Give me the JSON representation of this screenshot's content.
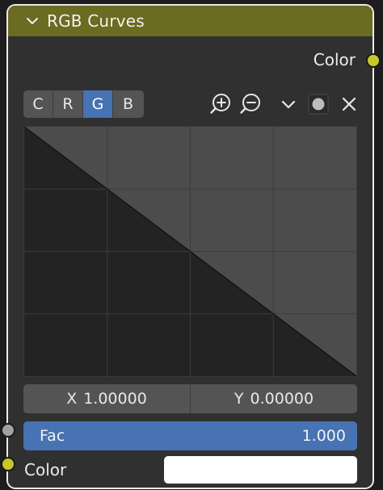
{
  "node": {
    "title": "RGB Curves",
    "header_color": "#6b6b21"
  },
  "outputs": {
    "color_label": "Color"
  },
  "channels": {
    "items": [
      {
        "label": "C",
        "active": false
      },
      {
        "label": "R",
        "active": false
      },
      {
        "label": "G",
        "active": true
      },
      {
        "label": "B",
        "active": false
      }
    ],
    "active_color": "#4772b3"
  },
  "tools": {
    "icons": [
      "zoom-in-icon",
      "zoom-out-icon",
      "chevron-down-icon",
      "record-icon",
      "close-icon"
    ]
  },
  "curve": {
    "points": [
      [
        0,
        1
      ],
      [
        1,
        0
      ]
    ],
    "grid_divisions": 4
  },
  "point": {
    "x_label": "X",
    "x_value": "1.00000",
    "y_label": "Y",
    "y_value": "0.00000"
  },
  "inputs": {
    "fac_label": "Fac",
    "fac_value": "1.000",
    "color_label": "Color",
    "color_value": "#ffffff"
  }
}
